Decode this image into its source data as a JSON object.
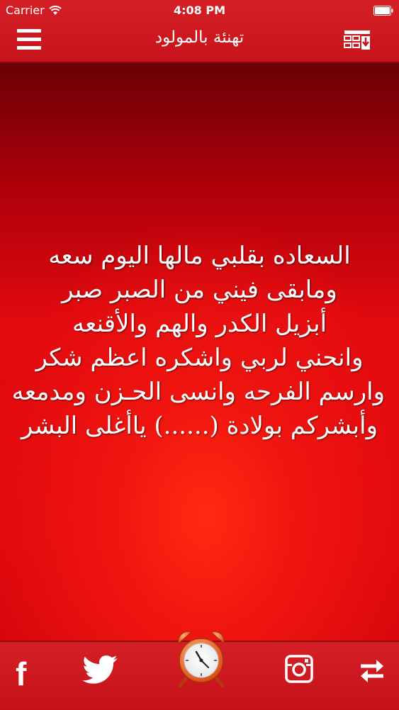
{
  "status_bar": {
    "carrier": "Carrier",
    "time": "4:08 PM"
  },
  "header": {
    "title": "تهنئة بالمولود",
    "menu_icon": "hamburger-icon",
    "right_icon": "grid-download-icon"
  },
  "poem": {
    "lines": [
      "السعاده بقلبي مالها اليوم سعه",
      "ومابقى فيني من الصبر صبر",
      "أبزيل الكدر والهم والأقنعه",
      "وانحني لربي واشكره اعظم شكر",
      "وارسم الفرحه وانسى الحـزن ومدمعه",
      "وأبشركم بولادة (......) ياأغلى البشر"
    ]
  },
  "toolbar": {
    "icons": [
      "facebook-icon",
      "twitter-icon",
      "alarm-clock-icon",
      "instagram-icon",
      "sync-icon"
    ]
  },
  "colors": {
    "primary": "#c7141a",
    "content_top": "#6a0004",
    "content_glow": "#ff2a10",
    "text": "#ffffff"
  }
}
